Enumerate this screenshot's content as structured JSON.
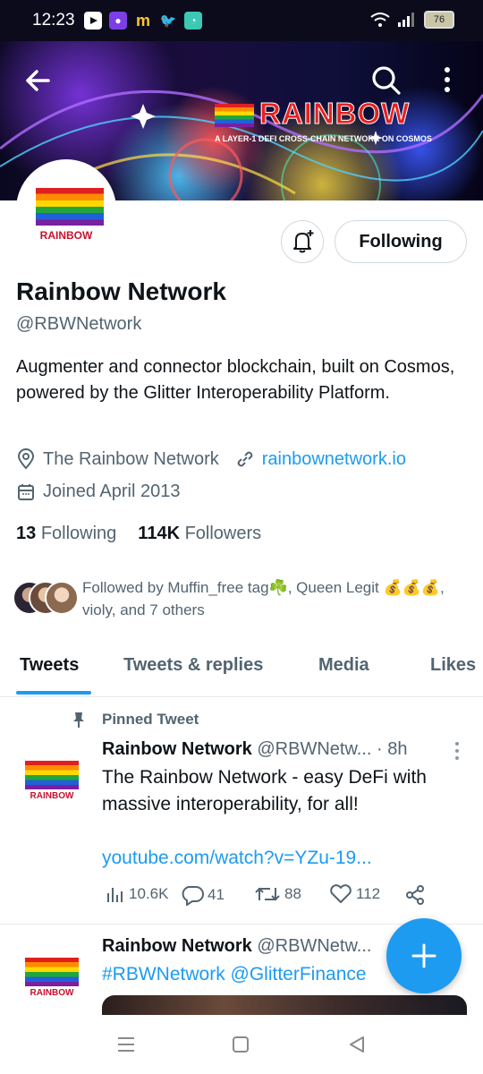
{
  "status_bar": {
    "time": "12:23",
    "battery": "76"
  },
  "banner": {
    "brand_word": "RAINBOW",
    "tagline": "A LAYER-1 DEFI CROSS-CHAIN NETWORK ON COSMOS"
  },
  "profile": {
    "avatar_word": "RAINBOW",
    "name": "Rainbow Network",
    "handle": "@RBWNetwork",
    "bio": "Augmenter and connector blockchain, built on Cosmos, powered by the Glitter Interoperability Platform.",
    "location": "The Rainbow Network",
    "website": "rainbownetwork.io",
    "joined": "Joined April 2013",
    "following_count": "13",
    "following_label": "Following",
    "followers_count": "114K",
    "followers_label": "Followers",
    "following_button": "Following",
    "followed_by": "Followed by Muffin_free tag☘️, Queen Legit 💰💰💰, violy, and 7 others"
  },
  "tabs": [
    "Tweets",
    "Tweets & replies",
    "Media",
    "Likes"
  ],
  "tweets": [
    {
      "pinned_label": "Pinned Tweet",
      "avatar_word": "RAINBOW",
      "author": "Rainbow Network",
      "handle": "@RBWNetw...",
      "time": "· 8h",
      "text": "The Rainbow Network - easy DeFi with massive interoperability, for all!",
      "link": "youtube.com/watch?v=YZu-19...",
      "views": "10.6K",
      "replies": "41",
      "retweets": "88",
      "likes": "112"
    },
    {
      "avatar_word": "RAINBOW",
      "author": "Rainbow Network",
      "handle": "@RBWNetw...",
      "text": "#RBWNetwork @GlitterFinance"
    }
  ],
  "colors": {
    "accent": "#1d9bf0",
    "text": "#0f1419",
    "muted": "#536471"
  }
}
